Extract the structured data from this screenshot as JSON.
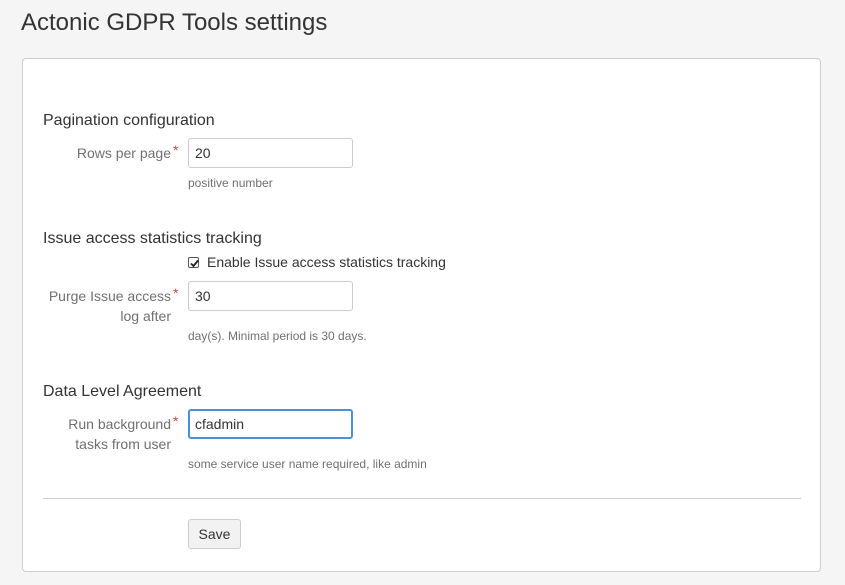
{
  "page": {
    "title": "Actonic GDPR Tools settings"
  },
  "pagination": {
    "heading": "Pagination configuration",
    "rows_label": "Rows per page",
    "rows_required": "*",
    "rows_value": "20",
    "rows_help": "positive number"
  },
  "tracking": {
    "heading": "Issue access statistics tracking",
    "checkbox_label": "Enable Issue access statistics tracking",
    "checkbox_checked": true,
    "purge_label_line1": "Purge Issue access",
    "purge_label_line2": "log after",
    "purge_required": "*",
    "purge_value": "30",
    "purge_help": "day(s). Minimal period is 30 days."
  },
  "dla": {
    "heading": "Data Level Agreement",
    "user_label_line1": "Run background",
    "user_label_line2": "tasks from user",
    "user_required": "*",
    "user_value": "cfadmin",
    "user_help": "some service user name required, like admin"
  },
  "actions": {
    "save_label": "Save"
  },
  "colors": {
    "required": "#d04437",
    "focus_border": "#4a90d9",
    "page_background": "#f5f5f5"
  },
  "icons": {
    "checkbox": "checkmark-icon"
  }
}
